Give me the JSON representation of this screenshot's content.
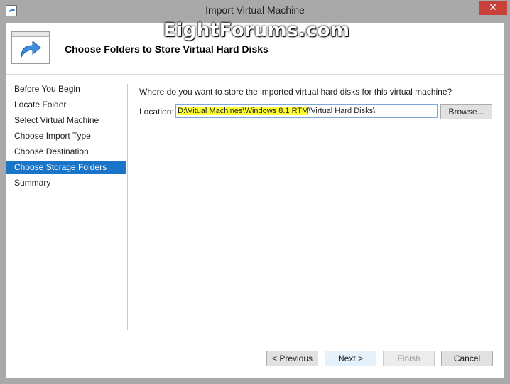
{
  "window": {
    "title": "Import Virtual Machine",
    "close_glyph": "✕"
  },
  "watermark": "EightForums.com",
  "header": {
    "title": "Choose Folders to Store Virtual Hard Disks",
    "icon": "import-arrow-icon"
  },
  "nav": {
    "items": [
      {
        "label": "Before You Begin"
      },
      {
        "label": "Locate Folder"
      },
      {
        "label": "Select Virtual Machine"
      },
      {
        "label": "Choose Import Type"
      },
      {
        "label": "Choose Destination"
      },
      {
        "label": "Choose Storage Folders"
      },
      {
        "label": "Summary"
      }
    ],
    "selected_index": 5
  },
  "main": {
    "question": "Where do you want to store the imported virtual hard disks for this virtual machine?",
    "location_label": "Location:",
    "location_value_highlighted": "D:\\Vitual Machines\\Windows 8.1 RTM",
    "location_value_rest": "\\Virtual Hard Disks\\",
    "browse_label": "Browse..."
  },
  "footer": {
    "previous_label": "< Previous",
    "next_label": "Next >",
    "finish_label": "Finish",
    "cancel_label": "Cancel"
  },
  "colors": {
    "selected_nav": "#1a74c8",
    "highlight": "#ffff33",
    "close_button": "#c7403a",
    "frame": "#a9a9a9"
  }
}
